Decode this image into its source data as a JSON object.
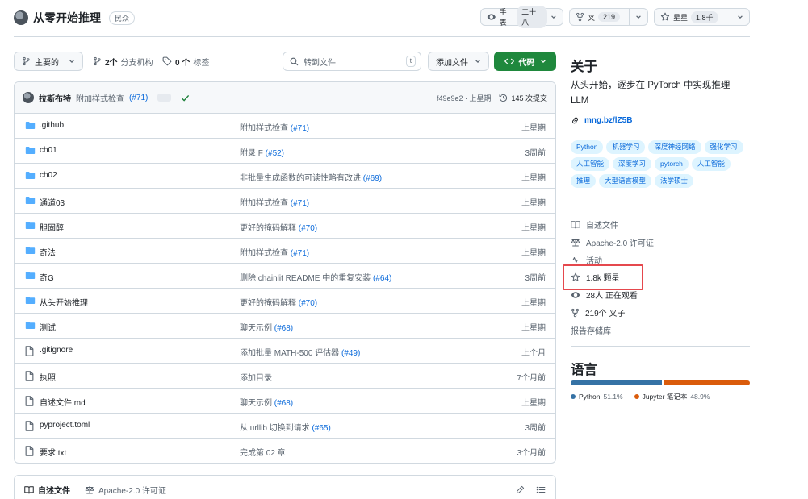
{
  "repo": {
    "name": "从零开始推理",
    "visibility": "民众"
  },
  "header_actions": {
    "watch_label": "手表",
    "watch_count": "二十八",
    "fork_label": "叉",
    "fork_count": "219",
    "star_label": "星星",
    "star_count": "1.8千"
  },
  "toolbar": {
    "branch": "主要的",
    "branches_count": "2个",
    "branches_label": "分支机构",
    "tags_count": "0 个",
    "tags_label": "标签",
    "search_placeholder": "转到文件",
    "search_shortcut": "t",
    "add_file": "添加文件",
    "code": "代码"
  },
  "latest_commit": {
    "author": "拉斯布特",
    "message": "附加样式检查",
    "pr": "(#71)",
    "hash": "f49e9e2 · 上星期",
    "history": "145 次提交",
    "more": "···"
  },
  "files": [
    {
      "type": "dir",
      "name": ".github",
      "message": "附加样式检查",
      "pr": "(#71)",
      "age": "上星期"
    },
    {
      "type": "dir",
      "name": "ch01",
      "message": "附录 F",
      "pr": "(#52)",
      "age": "3周前"
    },
    {
      "type": "dir",
      "name": "ch02",
      "message": "非批量生成函数的可读性略有改进",
      "pr": "(#69)",
      "age": "上星期"
    },
    {
      "type": "dir",
      "name": "通道03",
      "message": "附加样式检查",
      "pr": "(#71)",
      "age": "上星期"
    },
    {
      "type": "dir",
      "name": "胆固醇",
      "message": "更好的掩码解释",
      "pr": "(#70)",
      "age": "上星期"
    },
    {
      "type": "dir",
      "name": "奇法",
      "message": "附加样式检查",
      "pr": "(#71)",
      "age": "上星期"
    },
    {
      "type": "dir",
      "name": "奇G",
      "message": "删除 chainlit README 中的重复安装",
      "pr": "(#64)",
      "age": "3周前"
    },
    {
      "type": "dir",
      "name": "从头开始推理",
      "message": "更好的掩码解释",
      "pr": "(#70)",
      "age": "上星期"
    },
    {
      "type": "dir",
      "name": "测试",
      "message": "聊天示例",
      "pr": "(#68)",
      "age": "上星期"
    },
    {
      "type": "file",
      "name": ".gitignore",
      "message": "添加批量 MATH-500 评估器",
      "pr": "(#49)",
      "age": "上个月"
    },
    {
      "type": "file",
      "name": "执照",
      "message": "添加目录",
      "pr": "",
      "age": "7个月前"
    },
    {
      "type": "file",
      "name": "自述文件.md",
      "message": "聊天示例",
      "pr": "(#68)",
      "age": "上星期"
    },
    {
      "type": "file",
      "name": "pyproject.toml",
      "message": "从 urllib 切换到请求",
      "pr": "(#65)",
      "age": "3周前"
    },
    {
      "type": "file",
      "name": "要求.txt",
      "message": "完成第 02 章",
      "pr": "",
      "age": "3个月前"
    }
  ],
  "readme_bar": {
    "readme": "自述文件",
    "license": "Apache-2.0 许可证"
  },
  "about": {
    "heading": "关于",
    "description": "从头开始，逐步在 PyTorch 中实现推理 LLM",
    "homepage": "mng.bz/lZ5B",
    "topics": [
      "Python",
      "机器学习",
      "深度神经网络",
      "强化学习",
      "人工智能",
      "深度学习",
      "pytorch",
      "人工智能",
      "推理",
      "大型语言模型",
      "法学硕士"
    ],
    "readme": "自述文件",
    "license": "Apache-2.0 许可证",
    "activity": "活动",
    "stars": "1.8k 颗星",
    "watching": "28人 正在观看",
    "forks": "219个 叉子",
    "report": "报告存储库"
  },
  "languages": {
    "heading": "语言",
    "items": [
      {
        "name": "Python",
        "percent": "51.1%",
        "value": 51.1,
        "color": "#3572A5"
      },
      {
        "name": "Jupyter 笔记本",
        "percent": "48.9%",
        "value": 48.9,
        "color": "#DA5B0B"
      }
    ]
  },
  "colors": {
    "accent": "#0969da",
    "code_button": "#1f883d",
    "highlight": "#e5484d",
    "folder": "#54aeff"
  }
}
